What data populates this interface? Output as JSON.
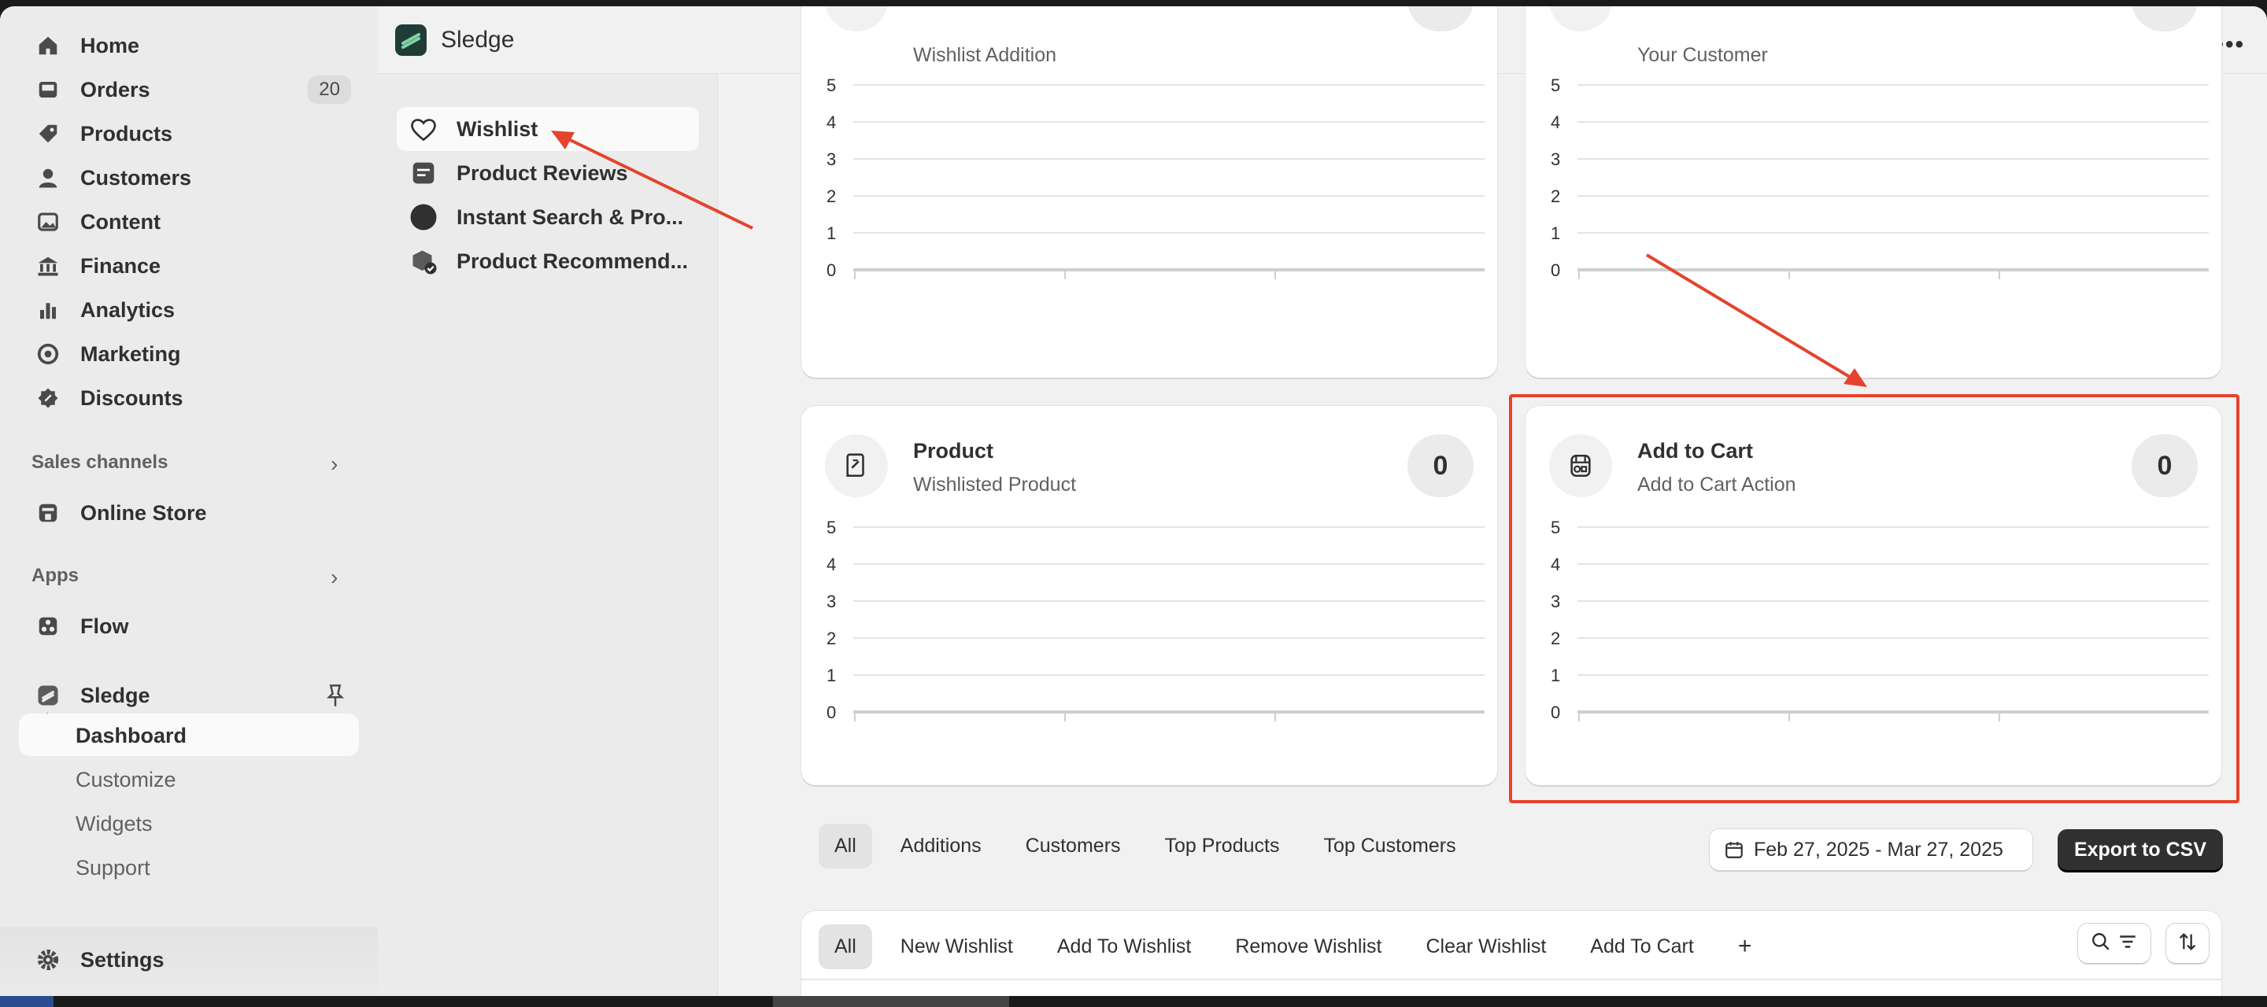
{
  "nav": {
    "items": [
      {
        "label": "Home",
        "icon": "home-icon"
      },
      {
        "label": "Orders",
        "icon": "inbox-icon",
        "badge": "20"
      },
      {
        "label": "Products",
        "icon": "tag-icon"
      },
      {
        "label": "Customers",
        "icon": "person-icon"
      },
      {
        "label": "Content",
        "icon": "image-icon"
      },
      {
        "label": "Finance",
        "icon": "bank-icon"
      },
      {
        "label": "Analytics",
        "icon": "bar-chart-icon"
      },
      {
        "label": "Marketing",
        "icon": "target-icon"
      },
      {
        "label": "Discounts",
        "icon": "discount-icon"
      }
    ],
    "sales_channels_label": "Sales channels",
    "online_store_label": "Online Store",
    "apps_label": "Apps",
    "flow_label": "Flow",
    "sledge_label": "Sledge",
    "sub_items": [
      "Dashboard",
      "Customize",
      "Widgets",
      "Support"
    ],
    "settings_label": "Settings"
  },
  "app": {
    "title": "Sledge",
    "sidebar": [
      {
        "label": "Wishlist",
        "icon": "heart-icon"
      },
      {
        "label": "Product Reviews",
        "icon": "review-icon"
      },
      {
        "label": "Instant Search & Pro...",
        "icon": "search-circle-icon"
      },
      {
        "label": "Product Recommend...",
        "icon": "box-check-icon"
      }
    ]
  },
  "cards": [
    {
      "title": "",
      "subtitle": "Wishlist Addition",
      "count": ""
    },
    {
      "title": "",
      "subtitle": "Your Customer",
      "count": ""
    },
    {
      "title": "Product",
      "subtitle": "Wishlisted Product",
      "count": "0"
    },
    {
      "title": "Add to Cart",
      "subtitle": "Add to Cart Action",
      "count": "0"
    }
  ],
  "chart_data": [
    {
      "type": "line",
      "ylim": [
        0,
        5
      ],
      "y_ticks": [
        "5",
        "4",
        "3",
        "2",
        "1",
        "0"
      ],
      "series": []
    },
    {
      "type": "line",
      "ylim": [
        0,
        5
      ],
      "y_ticks": [
        "5",
        "4",
        "3",
        "2",
        "1",
        "0"
      ],
      "series": []
    },
    {
      "type": "line",
      "ylim": [
        0,
        5
      ],
      "y_ticks": [
        "5",
        "4",
        "3",
        "2",
        "1",
        "0"
      ],
      "series": []
    },
    {
      "type": "line",
      "ylim": [
        0,
        5
      ],
      "y_ticks": [
        "5",
        "4",
        "3",
        "2",
        "1",
        "0"
      ],
      "series": []
    }
  ],
  "filters": {
    "tabs": [
      "All",
      "Additions",
      "Customers",
      "Top Products",
      "Top Customers"
    ],
    "date_range": "Feb 27, 2025 - Mar 27, 2025",
    "export_label": "Export to CSV"
  },
  "table": {
    "tabs": [
      "All",
      "New Wishlist",
      "Add To Wishlist",
      "Remove Wishlist",
      "Clear Wishlist",
      "Add To Cart"
    ],
    "add_label": "+"
  },
  "colors": {
    "annotation": "#e5432d",
    "primary_button": "#303030"
  }
}
